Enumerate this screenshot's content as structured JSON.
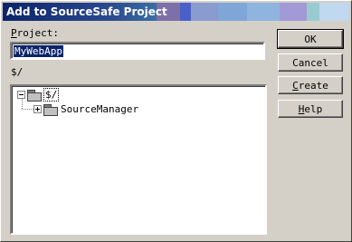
{
  "window": {
    "title": "Add to SourceSafe Project"
  },
  "form": {
    "project_label_mnemonic": "P",
    "project_label_rest": "roject:",
    "project_value": "MyWebApp",
    "current_path": "$/"
  },
  "tree": {
    "root": {
      "label": "$/",
      "expanded": true
    },
    "children": [
      {
        "label": "SourceManager",
        "expanded": false
      }
    ]
  },
  "buttons": {
    "ok": "OK",
    "cancel": "Cancel",
    "create_mnemonic": "C",
    "create_rest": "reate",
    "help_mnemonic": "H",
    "help_rest": "elp"
  },
  "colors": {
    "titlebar_start": "#0a246a",
    "selection": "#0a246a",
    "face": "#d4d0c8"
  }
}
